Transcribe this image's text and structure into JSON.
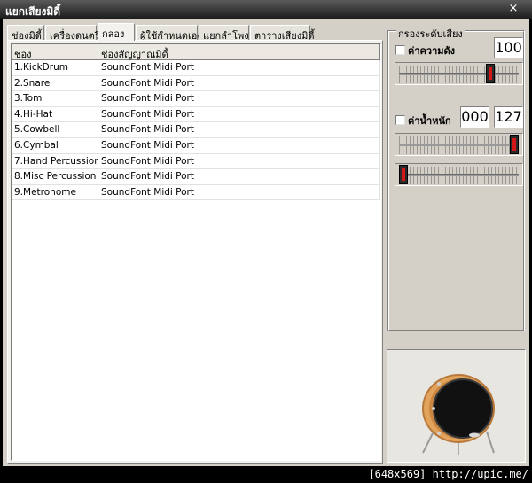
{
  "window": {
    "title": "แยกเสียงมิดี้",
    "close_glyph": "×"
  },
  "tabs": [
    {
      "label": "ช่องมิดี้",
      "active": false
    },
    {
      "label": "เครื่องดนตรี",
      "active": false
    },
    {
      "label": "กลอง",
      "active": true
    },
    {
      "label": "ผู้ใช้กำหนดเอง",
      "active": false
    },
    {
      "label": "แยกลำโพง",
      "active": false
    },
    {
      "label": "ตารางเสียงมิดี้",
      "active": false
    }
  ],
  "list": {
    "columns": [
      "ช่อง",
      "ช่องสัญญาณมิดี้"
    ],
    "rows": [
      [
        "1.KickDrum",
        "SoundFont Midi Port"
      ],
      [
        "2.Snare",
        "SoundFont Midi Port"
      ],
      [
        "3.Tom",
        "SoundFont Midi Port"
      ],
      [
        "4.Hi-Hat",
        "SoundFont Midi Port"
      ],
      [
        "5.Cowbell",
        "SoundFont Midi Port"
      ],
      [
        "6.Cymbal",
        "SoundFont Midi Port"
      ],
      [
        "7.Hand Percussion",
        "SoundFont Midi Port"
      ],
      [
        "8.Misc Percussion",
        "SoundFont Midi Port"
      ],
      [
        "9.Metronome",
        "SoundFont Midi Port"
      ]
    ]
  },
  "filter": {
    "group_title": "กรองระดับเสียง",
    "sustain": {
      "label": "ค่าความดัง",
      "checked": false,
      "value": "100",
      "slider_fraction": 0.78
    },
    "weight": {
      "label": "ค่าน้ำหนัก",
      "checked": false,
      "min_value": "000",
      "max_value": "127",
      "max_slider_fraction": 1.0,
      "min_slider_fraction": 0.0
    }
  },
  "image_panel": {
    "icon": "bass-drum-icon"
  },
  "watermark": "[648x569] http://upic.me/",
  "colors": {
    "thumb_red": "#d01818",
    "drum_shell": "#e2a35c",
    "drum_head": "#111111"
  }
}
